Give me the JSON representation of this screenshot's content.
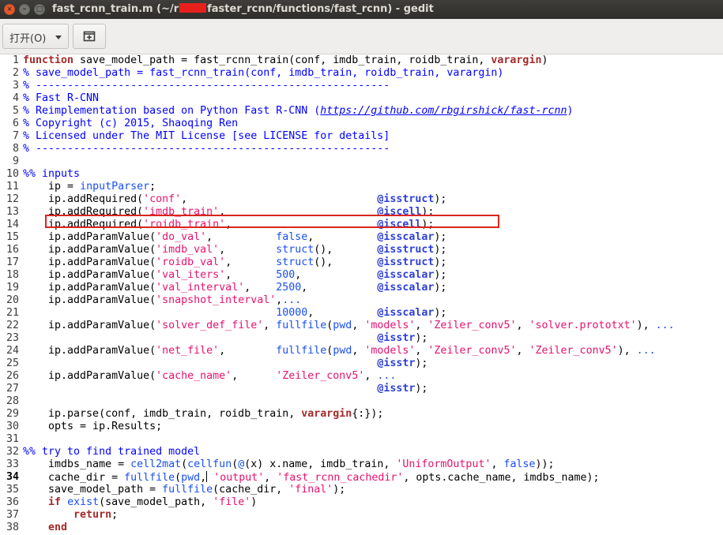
{
  "window": {
    "title_prefix": "fast_rcnn_train.m (~/r",
    "title_suffix": "faster_rcnn/functions/fast_rcnn) - gedit",
    "close_glyph": "×",
    "min_glyph": "–",
    "max_glyph": "□"
  },
  "toolbar": {
    "open_label": "打开(O)",
    "new_icon": "new-document-icon"
  },
  "colors": {
    "keyword": "#a52a2a",
    "string": "#e6126f",
    "comment": "#0000ff",
    "builtin": "#1a4ff0",
    "highlight_box": "#d9261c"
  },
  "editor": {
    "current_line": 34,
    "highlighted_line": 18,
    "lines": [
      "function save_model_path = fast_rcnn_train(conf, imdb_train, roidb_train, varargin)",
      "% save_model_path = fast_rcnn_train(conf, imdb_train, roidb_train, varargin)",
      "% --------------------------------------------------------",
      "% Fast R-CNN",
      "% Reimplementation based on Python Fast R-CNN (https://github.com/rbgirshick/fast-rcnn)",
      "% Copyright (c) 2015, Shaoqing Ren",
      "% Licensed under The MIT License [see LICENSE for details]",
      "% --------------------------------------------------------",
      "",
      "%% inputs",
      "    ip = inputParser;",
      "    ip.addRequired('conf',                              @isstruct);",
      "    ip.addRequired('imdb_train',                        @iscell);",
      "    ip.addRequired('roidb_train',                       @iscell);",
      "    ip.addParamValue('do_val',          false,          @isscalar);",
      "    ip.addParamValue('imdb_val',        struct(),       @isstruct);",
      "    ip.addParamValue('roidb_val',       struct(),       @isstruct);",
      "    ip.addParamValue('val_iters',       500,            @isscalar);",
      "    ip.addParamValue('val_interval',    2500,           @isscalar);",
      "    ip.addParamValue('snapshot_interval',...",
      "                                        10000,          @isscalar);",
      "    ip.addParamValue('solver_def_file', fullfile(pwd, 'models', 'Zeiler_conv5', 'solver.prototxt'), ...",
      "                                                        @isstr);",
      "    ip.addParamValue('net_file',        fullfile(pwd, 'models', 'Zeiler_conv5', 'Zeiler_conv5'), ...",
      "                                                        @isstr);",
      "    ip.addParamValue('cache_name',      'Zeiler_conv5', ...",
      "                                                        @isstr);",
      "",
      "    ip.parse(conf, imdb_train, roidb_train, varargin{:});",
      "    opts = ip.Results;",
      "",
      "%% try to find trained model",
      "    imdbs_name = cell2mat(cellfun(@(x) x.name, imdb_train, 'UniformOutput', false));",
      "    cache_dir = fullfile(pwd, 'output', 'fast_rcnn_cachedir', opts.cache_name, imdbs_name);",
      "    save_model_path = fullfile(cache_dir, 'final');",
      "    if exist(save_model_path, 'file')",
      "        return;",
      "    end"
    ]
  }
}
